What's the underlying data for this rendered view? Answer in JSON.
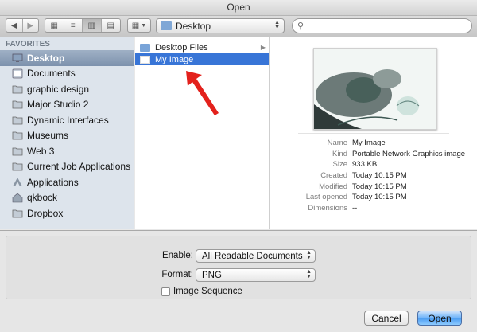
{
  "window": {
    "title": "Open"
  },
  "toolbar": {
    "location": "Desktop",
    "search_placeholder": ""
  },
  "sidebar": {
    "header": "FAVORITES",
    "items": [
      {
        "label": "Desktop",
        "icon": "desktop-icon",
        "selected": true
      },
      {
        "label": "Documents",
        "icon": "documents-icon"
      },
      {
        "label": "graphic design",
        "icon": "folder-icon"
      },
      {
        "label": "Major Studio 2",
        "icon": "folder-icon"
      },
      {
        "label": "Dynamic Interfaces",
        "icon": "folder-icon"
      },
      {
        "label": "Museums",
        "icon": "folder-icon"
      },
      {
        "label": "Web 3",
        "icon": "folder-icon"
      },
      {
        "label": "Current Job Applications",
        "icon": "folder-icon"
      },
      {
        "label": "Applications",
        "icon": "applications-icon"
      },
      {
        "label": "qkbock",
        "icon": "home-icon"
      },
      {
        "label": "Dropbox",
        "icon": "dropbox-folder-icon"
      }
    ]
  },
  "files": [
    {
      "name": "Desktop Files",
      "type": "folder"
    },
    {
      "name": "My Image",
      "type": "image",
      "selected": true
    }
  ],
  "preview": {
    "info": [
      {
        "key": "Name",
        "value": "My Image"
      },
      {
        "key": "Kind",
        "value": "Portable Network Graphics image"
      },
      {
        "key": "Size",
        "value": "933 KB"
      },
      {
        "key": "Created",
        "value": "Today 10:15 PM"
      },
      {
        "key": "Modified",
        "value": "Today 10:15 PM"
      },
      {
        "key": "Last opened",
        "value": "Today 10:15 PM"
      },
      {
        "key": "Dimensions",
        "value": "--"
      }
    ]
  },
  "options": {
    "enable_label": "Enable:",
    "enable_value": "All Readable Documents",
    "format_label": "Format:",
    "format_value": "PNG",
    "image_sequence_label": "Image Sequence",
    "image_sequence_checked": false
  },
  "buttons": {
    "cancel": "Cancel",
    "open": "Open"
  },
  "colors": {
    "selection": "#3875d7",
    "sidebar_bg": "#dde4ec",
    "annotation_arrow": "#e3211c"
  }
}
